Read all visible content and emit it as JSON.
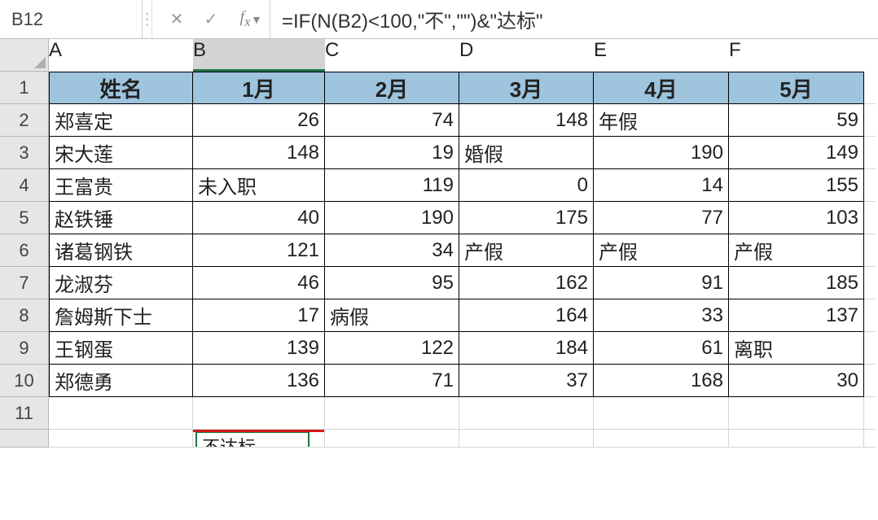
{
  "formula_bar": {
    "name_box": "B12",
    "formula": "=IF(N(B2)<100,\"不\",\"\")&\"达标\""
  },
  "columns": [
    "A",
    "B",
    "C",
    "D",
    "E",
    "F"
  ],
  "active_column_index": 1,
  "row_numbers": [
    "1",
    "2",
    "3",
    "4",
    "5",
    "6",
    "7",
    "8",
    "9",
    "10",
    "11"
  ],
  "table": {
    "headers": [
      "姓名",
      "1月",
      "2月",
      "3月",
      "4月",
      "5月"
    ],
    "rows": [
      [
        "郑喜定",
        "26",
        "74",
        "148",
        "年假",
        "59"
      ],
      [
        "宋大莲",
        "148",
        "19",
        "婚假",
        "190",
        "149"
      ],
      [
        "王富贵",
        "未入职",
        "119",
        "0",
        "14",
        "155"
      ],
      [
        "赵铁锤",
        "40",
        "190",
        "175",
        "77",
        "103"
      ],
      [
        "诸葛钢铁",
        "121",
        "34",
        "产假",
        "产假",
        "产假"
      ],
      [
        "龙淑芬",
        "46",
        "95",
        "162",
        "91",
        "185"
      ],
      [
        "詹姆斯下士",
        "17",
        "病假",
        "164",
        "33",
        "137"
      ],
      [
        "王钢蛋",
        "139",
        "122",
        "184",
        "61",
        "离职"
      ],
      [
        "郑德勇",
        "136",
        "71",
        "37",
        "168",
        "30"
      ]
    ]
  },
  "active_cell": {
    "ref": "B12",
    "display_value": "不达标"
  },
  "chart_data": {
    "type": "table",
    "title": "",
    "columns": [
      "姓名",
      "1月",
      "2月",
      "3月",
      "4月",
      "5月"
    ],
    "rows": [
      {
        "姓名": "郑喜定",
        "1月": 26,
        "2月": 74,
        "3月": 148,
        "4月": "年假",
        "5月": 59
      },
      {
        "姓名": "宋大莲",
        "1月": 148,
        "2月": 19,
        "3月": "婚假",
        "4月": 190,
        "5月": 149
      },
      {
        "姓名": "王富贵",
        "1月": "未入职",
        "2月": 119,
        "3月": 0,
        "4月": 14,
        "5月": 155
      },
      {
        "姓名": "赵铁锤",
        "1月": 40,
        "2月": 190,
        "3月": 175,
        "4月": 77,
        "5月": 103
      },
      {
        "姓名": "诸葛钢铁",
        "1月": 121,
        "2月": 34,
        "3月": "产假",
        "4月": "产假",
        "5月": "产假"
      },
      {
        "姓名": "龙淑芬",
        "1月": 46,
        "2月": 95,
        "3月": 162,
        "4月": 91,
        "5月": 185
      },
      {
        "姓名": "詹姆斯下士",
        "1月": 17,
        "2月": "病假",
        "3月": 164,
        "4月": 33,
        "5月": 137
      },
      {
        "姓名": "王钢蛋",
        "1月": 139,
        "2月": 122,
        "3月": 184,
        "4月": 61,
        "5月": "离职"
      },
      {
        "姓名": "郑德勇",
        "1月": 136,
        "2月": 71,
        "3月": 37,
        "4月": 168,
        "5月": 30
      }
    ]
  }
}
